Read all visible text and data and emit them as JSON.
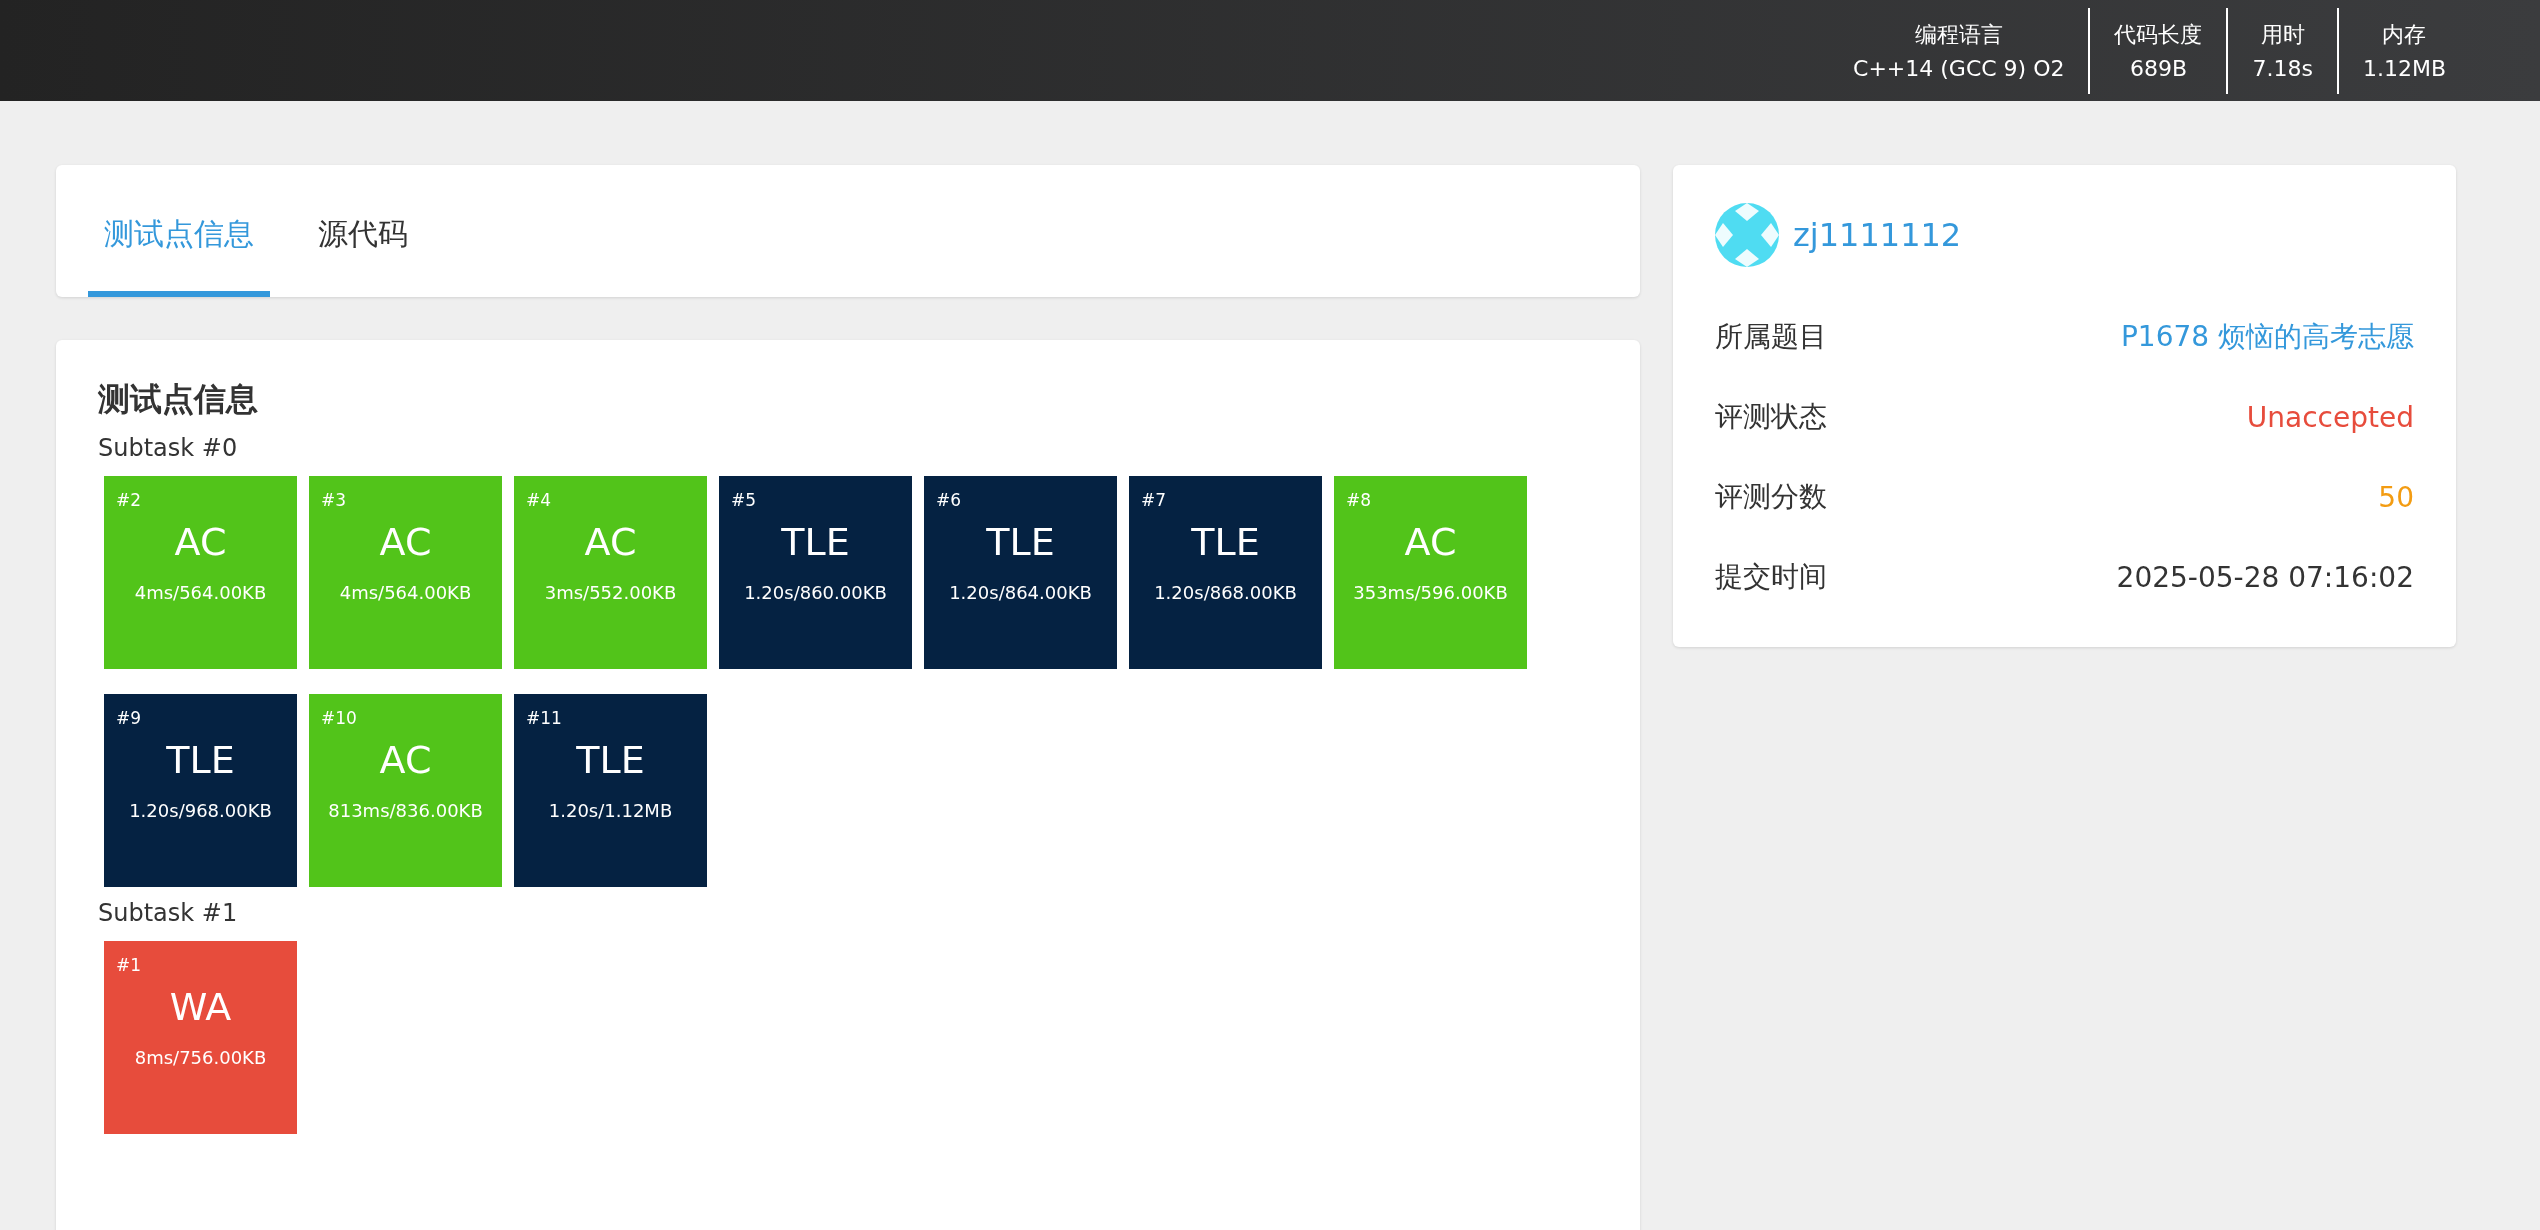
{
  "top_bar": {
    "stats": [
      {
        "label": "编程语言",
        "value": "C++14 (GCC 9) O2"
      },
      {
        "label": "代码长度",
        "value": "689B"
      },
      {
        "label": "用时",
        "value": "7.18s"
      },
      {
        "label": "内存",
        "value": "1.12MB"
      }
    ]
  },
  "tabs": [
    {
      "label": "测试点信息",
      "selected": true
    },
    {
      "label": "源代码",
      "selected": false
    }
  ],
  "testcases": {
    "title": "测试点信息",
    "subtasks": [
      {
        "label": "Subtask #0",
        "cases": [
          {
            "id": "#2",
            "status": "AC",
            "detail": "4ms/564.00KB"
          },
          {
            "id": "#3",
            "status": "AC",
            "detail": "4ms/564.00KB"
          },
          {
            "id": "#4",
            "status": "AC",
            "detail": "3ms/552.00KB"
          },
          {
            "id": "#5",
            "status": "TLE",
            "detail": "1.20s/860.00KB"
          },
          {
            "id": "#6",
            "status": "TLE",
            "detail": "1.20s/864.00KB"
          },
          {
            "id": "#7",
            "status": "TLE",
            "detail": "1.20s/868.00KB"
          },
          {
            "id": "#8",
            "status": "AC",
            "detail": "353ms/596.00KB"
          },
          {
            "id": "#9",
            "status": "TLE",
            "detail": "1.20s/968.00KB"
          },
          {
            "id": "#10",
            "status": "AC",
            "detail": "813ms/836.00KB"
          },
          {
            "id": "#11",
            "status": "TLE",
            "detail": "1.20s/1.12MB"
          }
        ]
      },
      {
        "label": "Subtask #1",
        "cases": [
          {
            "id": "#1",
            "status": "WA",
            "detail": "8ms/756.00KB"
          }
        ]
      }
    ]
  },
  "info_card": {
    "user": "zj1111112",
    "rows": [
      {
        "label": "所属题目",
        "value": "P1678 烦恼的高考志愿",
        "kind": "link"
      },
      {
        "label": "评测状态",
        "value": "Unaccepted",
        "kind": "status"
      },
      {
        "label": "评测分数",
        "value": "50",
        "kind": "score"
      },
      {
        "label": "提交时间",
        "value": "2025-05-28 07:16:02",
        "kind": "text"
      }
    ]
  }
}
